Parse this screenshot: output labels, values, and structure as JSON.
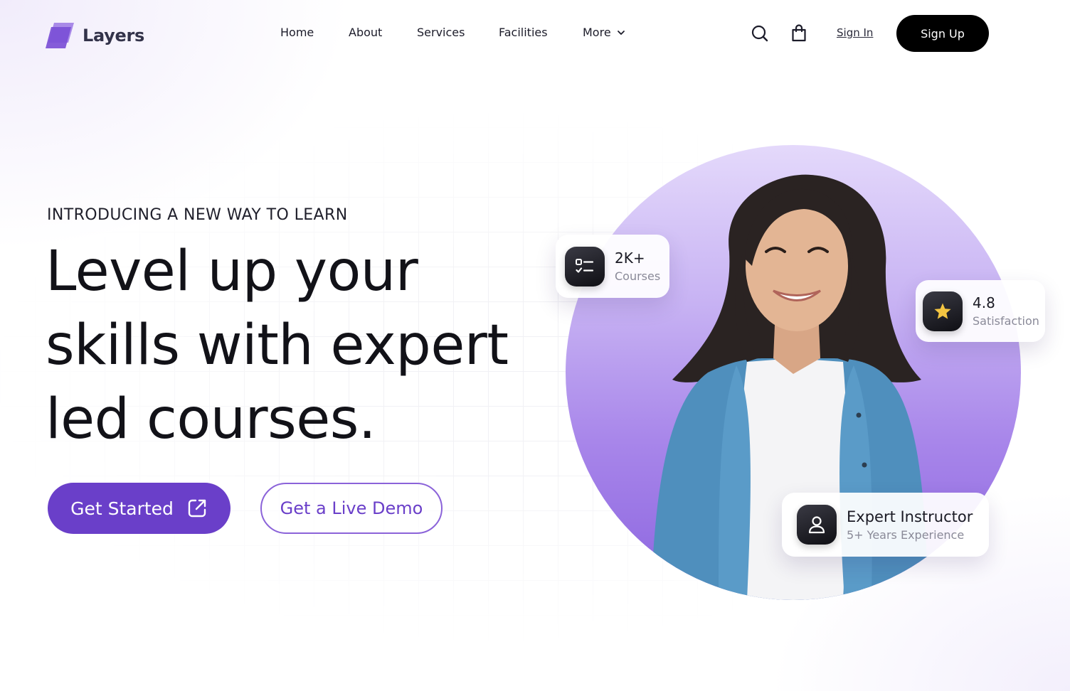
{
  "brand": {
    "name": "Layers",
    "colors": {
      "primary": "#6a3fc9",
      "logo": "#8b63d9",
      "star": "#f4c542",
      "dark": "#000000"
    }
  },
  "nav": {
    "items": [
      {
        "label": "Home"
      },
      {
        "label": "About"
      },
      {
        "label": "Services"
      },
      {
        "label": "Facilities"
      },
      {
        "label": "More"
      }
    ],
    "icons": [
      "search-icon",
      "shopping-bag-icon",
      "chevron-down-icon"
    ],
    "sign_in": "Sign In",
    "sign_up": "Sign Up"
  },
  "hero": {
    "eyebrow": "INTRODUCING A NEW WAY TO LEARN",
    "headline_lines": [
      "Level up your",
      "skills with expert",
      "led courses."
    ],
    "cta_primary": "Get Started",
    "cta_primary_icon": "external-link-icon",
    "cta_secondary": "Get a Live Demo"
  },
  "stats": {
    "courses": {
      "value": "2K+",
      "label": "Courses",
      "icon": "checklist-icon"
    },
    "rating": {
      "value": "4.8",
      "label": "Satisfaction",
      "icon": "star-icon"
    },
    "instructor": {
      "value": "Expert Instructor",
      "label": "5+ Years Experience",
      "icon": "user-icon"
    }
  }
}
